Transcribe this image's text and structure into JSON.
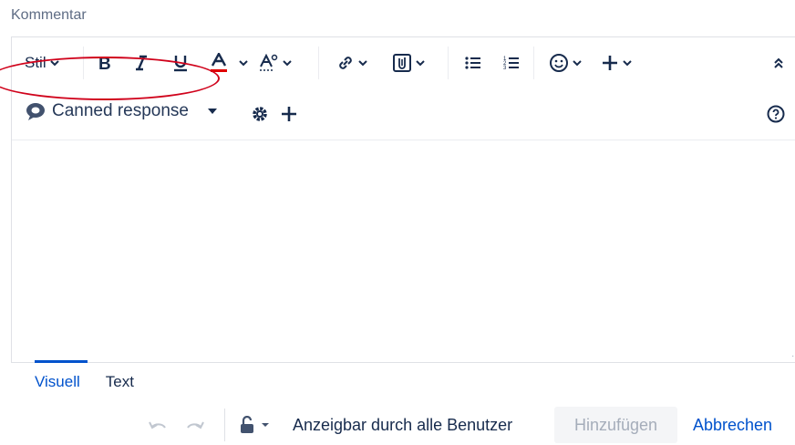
{
  "field_label": "Kommentar",
  "toolbar": {
    "style_label": "Stil",
    "colors": {
      "text_color_underline": "#e00000",
      "accent": "#0052cc"
    }
  },
  "canned": {
    "label": "Canned response"
  },
  "tabs": [
    {
      "label": "Visuell",
      "active": true
    },
    {
      "label": "Text",
      "active": false
    }
  ],
  "footer": {
    "visibility_label": "Anzeigbar durch alle Benutzer",
    "add_label": "Hinzufügen",
    "cancel_label": "Abbrechen"
  },
  "icons": [
    "bold-icon",
    "italic-icon",
    "underline-icon",
    "text-color-icon",
    "text-format-icon",
    "link-icon",
    "attachment-icon",
    "bullet-list-icon",
    "numbered-list-icon",
    "emoji-icon",
    "insert-more-icon",
    "collapse-toolbar-icon",
    "speech-bubble-icon",
    "caret-down-icon",
    "gear-icon",
    "plus-icon",
    "help-icon",
    "undo-icon",
    "redo-icon",
    "lock-icon"
  ]
}
